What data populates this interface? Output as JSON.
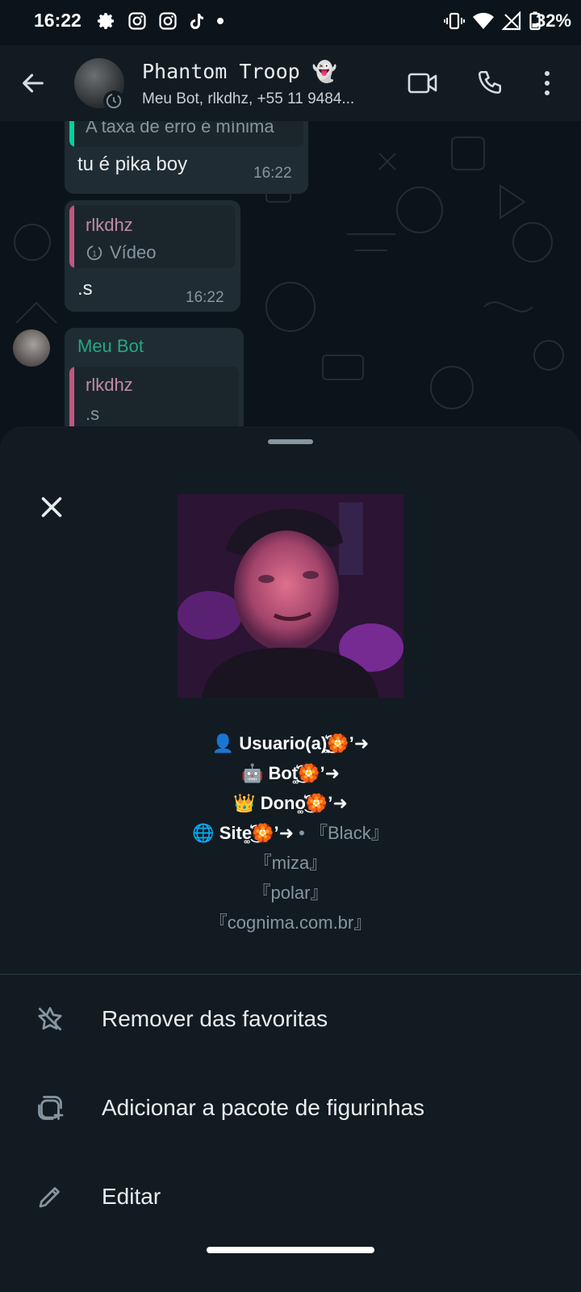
{
  "status_bar": {
    "time": "16:22",
    "left_icons": [
      "settings-icon",
      "instagram-icon",
      "instagram-icon",
      "tiktok-icon",
      "dot-icon"
    ],
    "right_icons": [
      "vibrate-icon",
      "wifi-icon",
      "signal-icon",
      "battery-icon"
    ],
    "battery": "32%"
  },
  "app_bar": {
    "title": "Phantom Troop 👻",
    "subtitle": "Meu Bot, rlkdhz, +55 11 9484..."
  },
  "messages": [
    {
      "quoted_text": "A taxa de erro é mínima",
      "text": "tu é pika boy",
      "time": "16:22"
    },
    {
      "quoted_name": "rlkdhz",
      "quoted_text": "Vídeo",
      "text": ".s",
      "time": "16:22"
    },
    {
      "sender": "Meu Bot",
      "quoted_name": "rlkdhz",
      "quoted_text": ".s"
    }
  ],
  "sticker_info": {
    "lines": [
      {
        "emoji": "👤",
        "label": "Usuario(a)͚͛͜͜͡͡🏵️’➜",
        "extra": ""
      },
      {
        "emoji": "🤖",
        "label": "Bot͚͛͜͡🏵️’➜",
        "extra": ""
      },
      {
        "emoji": "👑",
        "label": "Dono͚͛͜͡🏵️’➜",
        "extra": ""
      },
      {
        "emoji": "🌐",
        "label": "Site͚͛͜͡🏵️’➜",
        "extra": " • 『Black』"
      }
    ],
    "extra_lines": [
      "『miza』",
      "『polar』",
      "『cognima.com.br』"
    ]
  },
  "options": [
    {
      "icon": "star-off-icon",
      "label": "Remover das favoritas"
    },
    {
      "icon": "sticker-add-icon",
      "label": "Adicionar a pacote de figurinhas"
    },
    {
      "icon": "pencil-icon",
      "label": "Editar"
    }
  ]
}
